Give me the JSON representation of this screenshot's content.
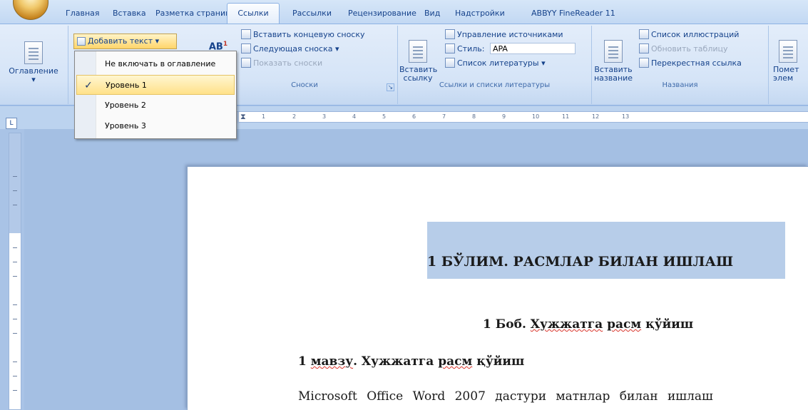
{
  "tabs": [
    {
      "label": "Главная",
      "active": false
    },
    {
      "label": "Вставка",
      "active": false
    },
    {
      "label": "Разметка страницы",
      "active": false
    },
    {
      "label": "Ссылки",
      "active": true
    },
    {
      "label": "Рассылки",
      "active": false
    },
    {
      "label": "Рецензирование",
      "active": false
    },
    {
      "label": "Вид",
      "active": false
    },
    {
      "label": "Надстройки",
      "active": false
    },
    {
      "label": "ABBYY FineReader 11",
      "active": false
    }
  ],
  "ribbon": {
    "toc": {
      "big_label": "Оглавление",
      "add_text_label": "Добавить текст",
      "dropdown_arrow": "▾"
    },
    "footnotes": {
      "insert_footnote_label": "AB",
      "insert_endnote": "Вставить концевую сноску",
      "next_footnote": "Следующая сноска",
      "show_notes": "Показать сноски",
      "group_label": "Сноски"
    },
    "citations": {
      "insert_citation_line1": "Вставить",
      "insert_citation_line2": "ссылку",
      "manage_sources": "Управление источниками",
      "style_label": "Стиль:",
      "style_value": "APA",
      "bibliography": "Список литературы",
      "group_label": "Ссылки и списки литературы"
    },
    "captions": {
      "insert_caption_line1": "Вставить",
      "insert_caption_line2": "название",
      "table_of_figures": "Список иллюстраций",
      "update_table": "Обновить таблицу",
      "cross_reference": "Перекрестная ссылка",
      "group_label": "Названия"
    },
    "index": {
      "mark_entry_line1": "Помет",
      "mark_entry_line2": "элем"
    }
  },
  "dropdown": {
    "items": [
      {
        "label": "Не включать в оглавление",
        "checked": false,
        "selected": false
      },
      {
        "label": "Уровень 1",
        "checked": true,
        "selected": true
      },
      {
        "label": "Уровень 2",
        "checked": false,
        "selected": false
      },
      {
        "label": "Уровень 3",
        "checked": false,
        "selected": false
      }
    ],
    "check_glyph": "✓"
  },
  "ruler": {
    "corner_glyph": "L",
    "ticks": [
      "1",
      "1",
      "2",
      "3",
      "4",
      "5",
      "6",
      "7",
      "8",
      "9",
      "10",
      "11",
      "12",
      "13"
    ]
  },
  "document": {
    "heading1": "1 БЎЛИМ. РАСМЛАР БИЛАН ИШЛАШ",
    "heading2_prefix": "1 Боб. ",
    "heading2_word1": "Хужжатга",
    "heading2_word2": "расм",
    "heading2_word3": "қўйиш",
    "heading3_prefix": "1 ",
    "heading3_word1": "мавзу",
    "heading3_rest": ". Хужжатга",
    "heading3_word2": "расм",
    "heading3_word3": "қўйиш",
    "paragraph": "Microsoft Office Word 2007 дастури матнлар билан ишлаш"
  },
  "colors": {
    "ribbon_bg": "#d5e4f7",
    "tab_text": "#15428b",
    "selected_item": "#ffe189",
    "heading_highlight": "#b7cde9",
    "workspace_bg": "#a4bfe3"
  }
}
